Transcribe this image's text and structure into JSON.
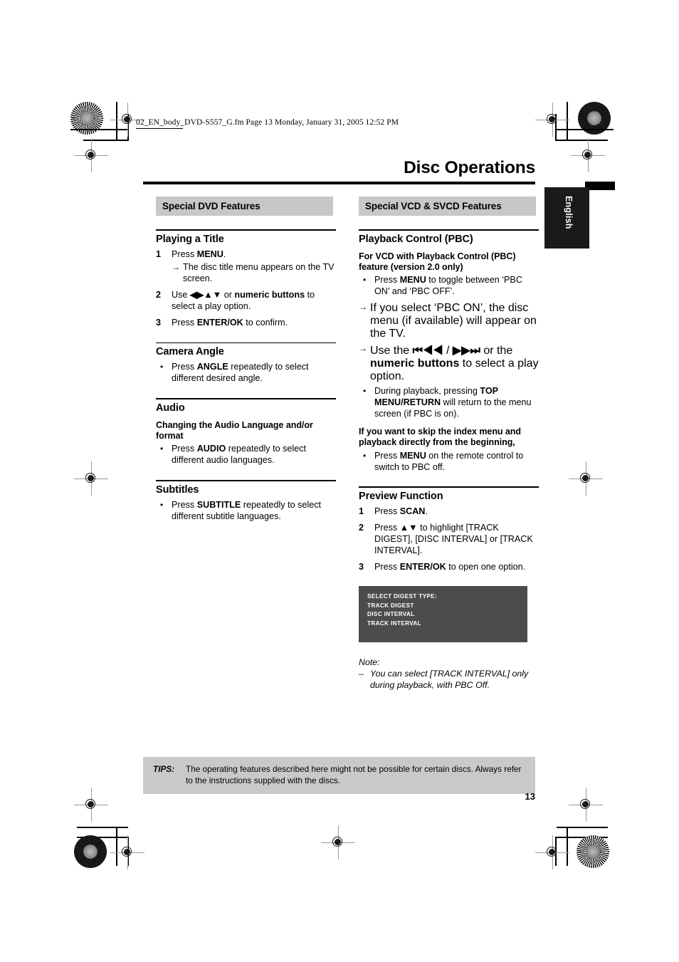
{
  "document": {
    "fm_header": "02_EN_body_DVD-S557_G.fm  Page 13  Monday, January 31, 2005  12:52 PM",
    "page_title": "Disc Operations",
    "language_tab": "English",
    "page_number": "13"
  },
  "left_column": {
    "section_band": "Special DVD Features",
    "playing_a_title": {
      "heading": "Playing a Title",
      "steps": [
        {
          "num": "1",
          "text_html": "Press <b>MENU</b>.",
          "arrow": "→",
          "arrow_text": "The disc title menu appears on the TV screen."
        },
        {
          "num": "2",
          "text_html": "Use <b>◀▶▲▼</b> or <b>numeric buttons</b> to select a play option."
        },
        {
          "num": "3",
          "text_html": "Press <b>ENTER/OK</b> to confirm."
        }
      ]
    },
    "camera_angle": {
      "heading": "Camera Angle",
      "bullet": "•",
      "items": [
        "Press <b>ANGLE</b> repeatedly to select different desired angle."
      ]
    },
    "audio": {
      "heading": "Audio",
      "subheading": "Changing the Audio Language and/or format",
      "bullet": "•",
      "items": [
        "Press <b>AUDIO</b> repeatedly to select different audio languages."
      ]
    },
    "subtitles": {
      "heading": "Subtitles",
      "bullet": "•",
      "items": [
        "Press <b>SUBTITLE</b> repeatedly to select different subtitle languages."
      ]
    }
  },
  "right_column": {
    "section_band": "Special VCD & SVCD Features",
    "playback_control": {
      "heading": "Playback Control (PBC)",
      "subheading": "For VCD with Playback Control (PBC) feature (version 2.0 only)",
      "bullet": "•",
      "arrow": "→",
      "lines": [
        {
          "marker": "bullet",
          "html": "Press <b>MENU</b> to toggle between ‘PBC ON’ and ‘PBC OFF’."
        },
        {
          "marker": "arrow",
          "html": "If you select ‘PBC ON’, the disc menu (if available) will appear on the TV."
        },
        {
          "marker": "arrow",
          "html": "Use the <b>⏮◀◀</b> / <b>▶▶⏭</b> or the <b>numeric buttons</b> to select a play option."
        },
        {
          "marker": "bullet",
          "html": "During playback, pressing <b>TOP MENU/RETURN</b> will return to the menu screen (if PBC is on)."
        }
      ],
      "skip_subheading": "If you want to skip the index menu and playback directly from the beginning,",
      "skip_items": [
        "Press <b>MENU</b> on the remote control to switch to PBC off."
      ]
    },
    "preview_function": {
      "heading": "Preview Function",
      "steps": [
        {
          "num": "1",
          "html": "Press <b>SCAN</b>."
        },
        {
          "num": "2",
          "html": "Press <b>▲▼</b> to highlight [TRACK DIGEST], [DISC INTERVAL] or [TRACK INTERVAL]."
        },
        {
          "num": "3",
          "html": "Press <b>ENTER/OK</b> to open one option."
        }
      ],
      "osd_screen": {
        "title": "SELECT DIGEST TYPE:",
        "options": [
          "TRACK DIGEST",
          "DISC INTERVAL",
          "TRACK INTERVAL"
        ],
        "bg_color": "#4d4b4b"
      },
      "note": {
        "label": "Note:",
        "dash": "–",
        "text": "You can select [TRACK INTERVAL] only during playback, with PBC Off."
      }
    }
  },
  "tips": {
    "label": "TIPS:",
    "text": "The operating features described here might not be possible for certain discs. Always refer to the instructions supplied with the discs."
  },
  "colors": {
    "band_gray": "#c7c7c7",
    "tips_gray": "#c9c9c9",
    "osd_gray": "#4d4b4b",
    "tab_black": "#1a1a1a"
  }
}
